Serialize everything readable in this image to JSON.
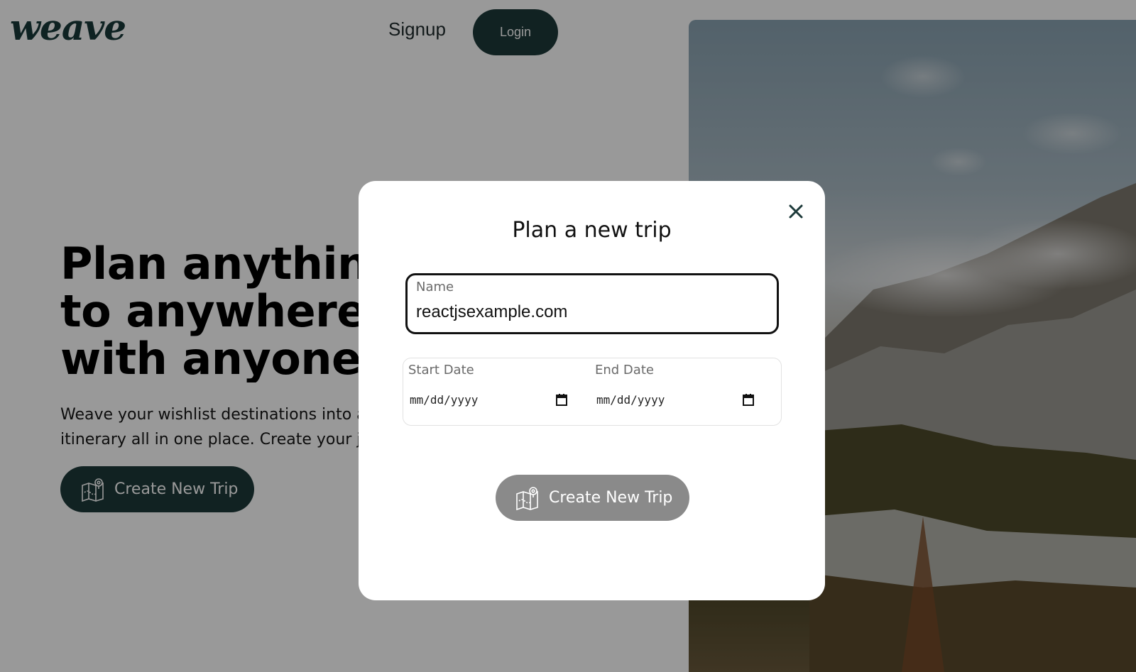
{
  "header": {
    "logo_text": "weave",
    "signup_label": "Signup",
    "login_label": "Login"
  },
  "hero": {
    "title_lines": [
      "Plan anything",
      "to anywhere,",
      "with anyone."
    ],
    "subtitle_lines": [
      "Weave your wishlist destinations into a s",
      "itinerary all in one place. Create your jo"
    ],
    "cta_label": "Create New Trip",
    "cta_icon": "map-pin-icon"
  },
  "modal": {
    "title": "Plan a new trip",
    "close_icon": "close-icon",
    "name_label": "Name",
    "name_value": "reactjsexample.com",
    "start_date_label": "Start Date",
    "start_date_placeholder": "mm/dd/yyyy",
    "end_date_label": "End Date",
    "end_date_placeholder": "mm/dd/yyyy",
    "calendar_icon": "calendar-icon",
    "cta_label": "Create New Trip",
    "cta_icon": "map-pin-icon"
  },
  "colors": {
    "brand_dark": "#1d3a3a",
    "overlay": "rgba(0,0,0,0.40)",
    "modal_cta_disabled": "#8a8a8a"
  }
}
